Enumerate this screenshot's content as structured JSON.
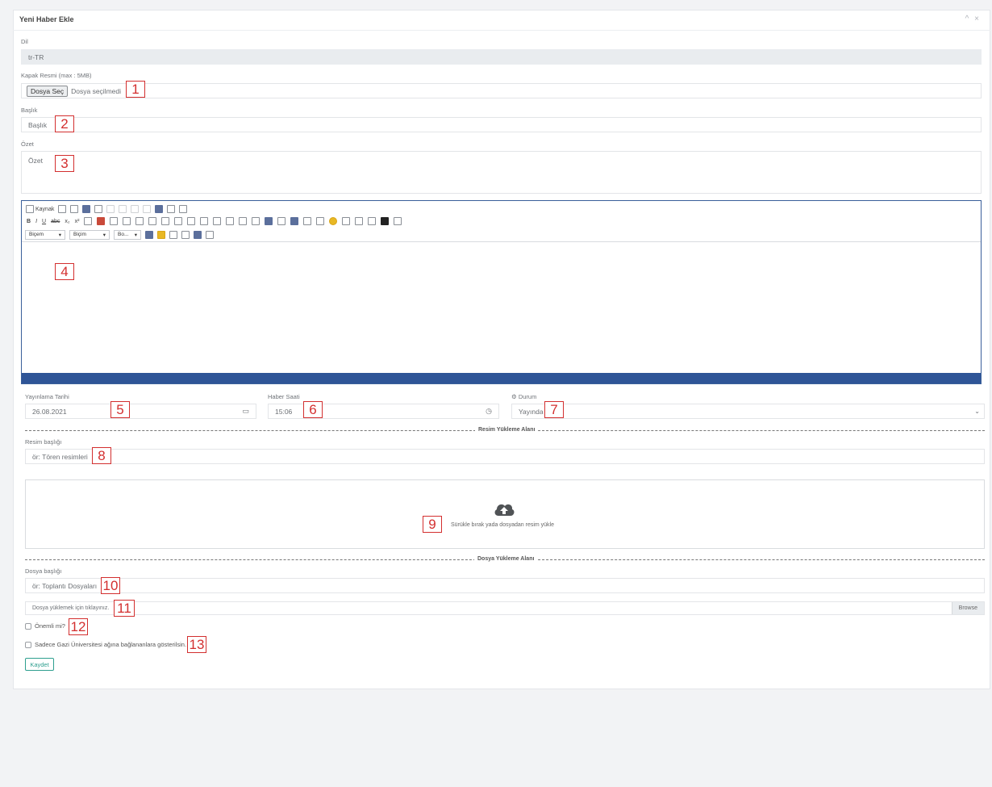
{
  "panel": {
    "title": "Yeni Haber Ekle",
    "tools": "^ ×"
  },
  "dil": {
    "label": "Dil",
    "value": "tr-TR"
  },
  "kapak": {
    "label": "Kapak Resmi (max : 5MB)",
    "button": "Dosya Seç",
    "status": "Dosya seçilmedi"
  },
  "baslik": {
    "label": "Başlık",
    "placeholder": "Başlık"
  },
  "ozet": {
    "label": "Özet",
    "placeholder": "Özet"
  },
  "editor": {
    "source_label": "Kaynak",
    "format_select": "Biçem",
    "style_select": "Biçim",
    "size_select": "Bo...",
    "bold": "B",
    "italic": "I",
    "underline": "U",
    "strike": "abc",
    "sub": "x₂",
    "sup": "x²"
  },
  "yayin_tarihi": {
    "label": "Yayınlama Tarihi",
    "value": "26.08.2021"
  },
  "haber_saati": {
    "label": "Haber Saati",
    "value": "15:06"
  },
  "durum": {
    "label": "Durum",
    "value": "Yayında"
  },
  "resim_section": {
    "title": "Resim Yükleme Alanı"
  },
  "resim_baslik": {
    "label": "Resim başlığı",
    "placeholder": "ör: Tören resimleri"
  },
  "dropzone": {
    "text": "Sürükle bırak yada dosyadan resim yükle"
  },
  "dosya_section": {
    "title": "Dosya Yükleme Alanı"
  },
  "dosya_baslik": {
    "label": "Dosya başlığı",
    "placeholder": "ör: Toplantı Dosyaları"
  },
  "dosya_yukle": {
    "placeholder": "Dosya yüklemek için tıklayınız.",
    "browse": "Browse"
  },
  "onemli": {
    "label": "Önemli mi?"
  },
  "gazi": {
    "label": "Sadece Gazi Üniversitesi ağına bağlananlara gösterilsin."
  },
  "save": {
    "label": "Kaydet"
  },
  "callouts": [
    "1",
    "2",
    "3",
    "4",
    "5",
    "6",
    "7",
    "8",
    "9",
    "10",
    "11",
    "12",
    "13"
  ],
  "colors": {
    "editor_bar": "#2f5597",
    "callout": "#d32f2f",
    "save": "#2e9f8f"
  }
}
